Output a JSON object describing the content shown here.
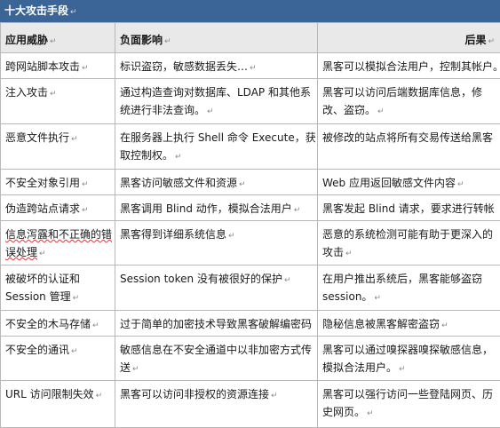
{
  "title": "十大攻击手段",
  "para_mark": "↵",
  "headers": [
    "应用威胁",
    "负面影响",
    "后果"
  ],
  "rows": [
    [
      "跨网站脚本攻击",
      "标识盗窃，敏感数据丢失…",
      "黑客可以模拟合法用户，控制其帐户。"
    ],
    [
      "注入攻击",
      "通过构造查询对数据库、LDAP 和其他系统进行非法查询。",
      "黑客可以访问后端数据库信息，修改、盗窃。"
    ],
    [
      "恶意文件执行",
      "在服务器上执行 Shell 命令 Execute，获取控制权。",
      "被修改的站点将所有交易传送给黑客"
    ],
    [
      "不安全对象引用",
      "黑客访问敏感文件和资源",
      "Web 应用返回敏感文件内容"
    ],
    [
      "伪造跨站点请求",
      "黑客调用 Blind 动作，模拟合法用户",
      "黑客发起 Blind 请求，要求进行转帐"
    ],
    [
      "信息泻露和不正确的错误处理",
      "黑客得到详细系统信息",
      "恶意的系统检测可能有助于更深入的攻击"
    ],
    [
      "被破坏的认证和 Session 管理",
      "Session token 没有被很好的保护",
      "在用户推出系统后，黑客能够盗窃 session。"
    ],
    [
      "不安全的木马存储",
      "过于简单的加密技术导致黑客破解编密码",
      "隐秘信息被黑客解密盗窃"
    ],
    [
      "不安全的通讯",
      "敏感信息在不安全通道中以非加密方式传送",
      "黑客可以通过嗅探器嗅探敏感信息，模拟合法用户。"
    ],
    [
      "URL 访问限制失效",
      "黑客可以访问非授权的资源连接",
      "黑客可以强行访问一些登陆网页、历史网页。"
    ]
  ]
}
